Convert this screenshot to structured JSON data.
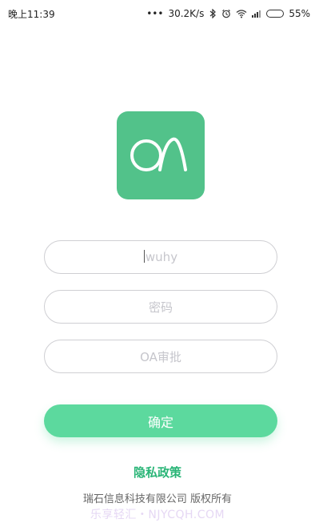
{
  "status_bar": {
    "time": "晚上11:39",
    "dots": "•••",
    "network_speed": "30.2K/s",
    "battery_percent": "55%",
    "battery_level": 0.55,
    "icons": [
      "bluetooth-icon",
      "alarm-icon",
      "wifi-icon",
      "signal-icon",
      "battery-icon"
    ]
  },
  "logo": {
    "text": "OA",
    "color": "#52c28a"
  },
  "form": {
    "username_value": "wuhy",
    "password_placeholder": "密码",
    "approval_field_value": "OA审批",
    "confirm_label": "确定",
    "confirm_color": "#5cd99e"
  },
  "footer": {
    "privacy_label": "隐私政策",
    "privacy_color": "#2ab577",
    "copyright": "瑞石信息科技有限公司 版权所有"
  },
  "watermark": {
    "text": "乐享轻汇・NJYCQH.COM"
  }
}
